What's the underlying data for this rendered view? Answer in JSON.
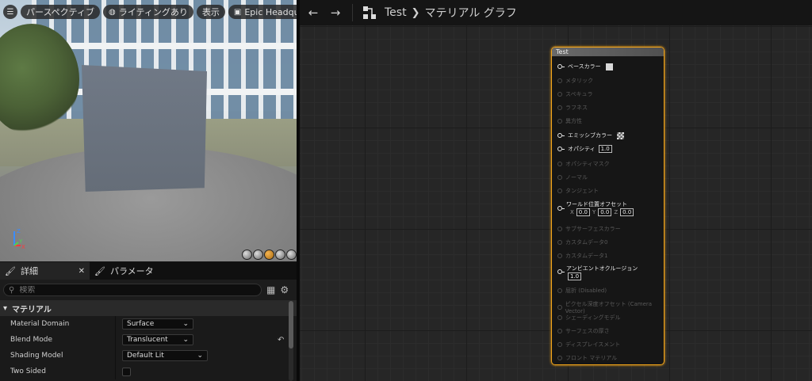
{
  "viewport": {
    "toolbar": {
      "menu_icon": "hamburger-icon",
      "perspective_label": "パースペクティブ",
      "lighting_label": "ライティングあり",
      "show_label": "表示",
      "scene_label": "Epic Headquarters"
    },
    "axis": {
      "x": "X",
      "y": "Y",
      "z": "Z"
    }
  },
  "details": {
    "tabs": [
      {
        "label": "詳細",
        "icon": "brush-icon"
      },
      {
        "label": "パラメータ",
        "icon": "brush-icon"
      }
    ],
    "search_placeholder": "検索",
    "section_title": "マテリアル",
    "properties": [
      {
        "label": "Material Domain",
        "value": "Surface"
      },
      {
        "label": "Blend Mode",
        "value": "Translucent"
      },
      {
        "label": "Shading Model",
        "value": "Default Lit"
      },
      {
        "label": "Two Sided",
        "value": ""
      }
    ]
  },
  "graph": {
    "breadcrumb": {
      "root": "Test",
      "current": "マテリアル グラフ"
    }
  },
  "node": {
    "title": "Test",
    "pins": [
      {
        "label": "ベースカラー",
        "enabled": true
      },
      {
        "label": "メタリック",
        "enabled": false
      },
      {
        "label": "スペキュラ",
        "enabled": false
      },
      {
        "label": "ラフネス",
        "enabled": false
      },
      {
        "label": "異方性",
        "enabled": false
      },
      {
        "label": "エミッシブカラー",
        "enabled": true
      },
      {
        "label": "オパシティ",
        "enabled": true,
        "value": "1.0"
      },
      {
        "label": "オパシティマスク",
        "enabled": false
      },
      {
        "label": "ノーマル",
        "enabled": false
      },
      {
        "label": "タンジェント",
        "enabled": false
      },
      {
        "label": "ワールド位置オフセット",
        "enabled": true,
        "x": "0.0",
        "y": "0.0",
        "z": "0.0"
      },
      {
        "label": "サブサーフェスカラー",
        "enabled": false
      },
      {
        "label": "カスタムデータ0",
        "enabled": false
      },
      {
        "label": "カスタムデータ1",
        "enabled": false
      },
      {
        "label": "アンビエントオクルージョン",
        "enabled": true,
        "value": "1.0"
      },
      {
        "label": "屈折 (Disabled)",
        "enabled": false
      },
      {
        "label": "ピクセル深度オフセット (Camera Vector)",
        "enabled": false
      },
      {
        "label": "シェーディングモデル",
        "enabled": false
      },
      {
        "label": "サーフェスの厚さ",
        "enabled": false
      },
      {
        "label": "ディスプレイスメント",
        "enabled": false
      },
      {
        "label": "フロント マテリアル",
        "enabled": false
      }
    ],
    "vec_labels": {
      "x": "X",
      "y": "Y",
      "z": "Z"
    }
  },
  "colors": {
    "accent": "#f3a51a",
    "panel": "#1a1a1a",
    "graph_bg": "#262626"
  }
}
